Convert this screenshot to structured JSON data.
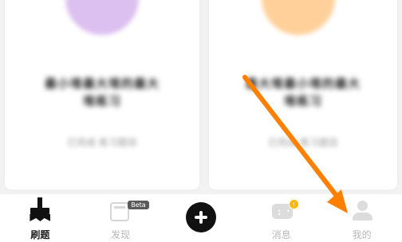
{
  "cards": [
    {
      "title_line1": "最小堆最大堆的最大",
      "title_line2": "堆练习",
      "subtitle": "已完成 练习题目"
    },
    {
      "title_line1": "最大堆最小堆的最大",
      "title_line2": "堆练习",
      "subtitle": "已完成 练习题目"
    }
  ],
  "nav": {
    "items": [
      {
        "label": "刷题",
        "icon": "brush-icon",
        "active": true
      },
      {
        "label": "发现",
        "icon": "discover-icon",
        "badge": "Beta"
      },
      {
        "label": "",
        "icon": "add-icon"
      },
      {
        "label": "消息",
        "icon": "message-icon",
        "badge": "!"
      },
      {
        "label": "我的",
        "icon": "person-icon"
      }
    ]
  },
  "colors": {
    "accent": "#ff7f00",
    "active_text": "#222222",
    "inactive": "#b8b8b8"
  }
}
